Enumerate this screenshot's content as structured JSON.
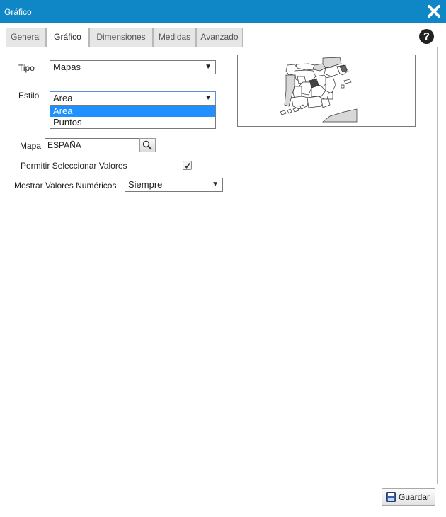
{
  "window": {
    "title": "Gráfico"
  },
  "tabs": [
    {
      "label": "General"
    },
    {
      "label": "Gráfico"
    },
    {
      "label": "Dimensiones"
    },
    {
      "label": "Medidas"
    },
    {
      "label": "Avanzado"
    }
  ],
  "help": {
    "label": "?"
  },
  "form": {
    "tipo_label": "Tipo",
    "tipo_value": "Mapas",
    "estilo_label": "Estilo",
    "estilo_value": "Area",
    "estilo_options": [
      "Area",
      "Puntos"
    ],
    "mapa_label": "Mapa",
    "mapa_value": "ESPAÑA",
    "permitir_label": "Permitir Seleccionar Valores",
    "permitir_checked": true,
    "mostrar_label": "Mostrar Valores Numéricos",
    "mostrar_value": "Siempre"
  },
  "footer": {
    "save_label": "Guardar"
  },
  "colors": {
    "titlebar": "#0f86c6",
    "selected_option": "#1e90ff"
  },
  "icons": {
    "close": "close-icon",
    "search": "search-icon",
    "save": "floppy-disk-icon",
    "check": "checkmark-icon",
    "help": "help-icon"
  }
}
